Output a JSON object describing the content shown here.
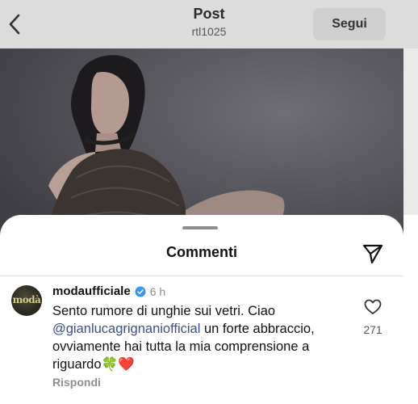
{
  "header": {
    "title": "Post",
    "subtitle": "rtl1025",
    "follow_label": "Segui",
    "back_icon": "chevron-left-icon"
  },
  "sheet": {
    "title": "Commenti",
    "send_icon": "paper-plane-icon"
  },
  "comment": {
    "avatar_text": "modà",
    "username": "modaufficiale",
    "verified": true,
    "time": "6 h",
    "text_before": "Sento rumore di unghie sui vetri. Ciao ",
    "mention": "@gianlucagrignaniofficial",
    "text_after": " un forte abbraccio, ovviamente hai tutta la mia comprensione a riguardo",
    "emojis": "🍀❤️",
    "reply_label": "Rispondi",
    "like_count": "271"
  },
  "colors": {
    "mention": "#3d4e8f",
    "verified_badge": "#3897f0",
    "heart_emoji": "#e0202a",
    "clover_emoji": "#3aa335"
  }
}
